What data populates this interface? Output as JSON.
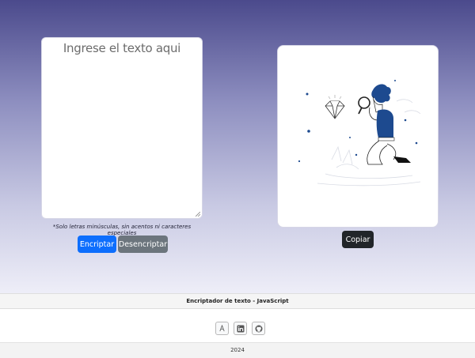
{
  "input": {
    "placeholder": "Ingrese el texto aqui",
    "hint": "*Solo letras minúsculas, sin acentos ni caracteres especiales"
  },
  "actions": {
    "encrypt_label": "Encriptar",
    "decrypt_label": "Desencriptar",
    "copy_label": "Copiar"
  },
  "output": {
    "illustration_icon": "person-with-magnifier-and-diamond"
  },
  "brand": {
    "title": "Encriptador de texto - JavaScript"
  },
  "social": [
    {
      "icon": "profile-icon"
    },
    {
      "icon": "linkedin-icon"
    },
    {
      "icon": "github-icon"
    }
  ],
  "footer": {
    "year": "2024"
  },
  "colors": {
    "gradient_top": "#4b4a8c",
    "encrypt_button": "#0d6efd",
    "decrypt_button": "#6c757d",
    "copy_button": "#212529",
    "illustration_accent": "#1d4a8f"
  }
}
